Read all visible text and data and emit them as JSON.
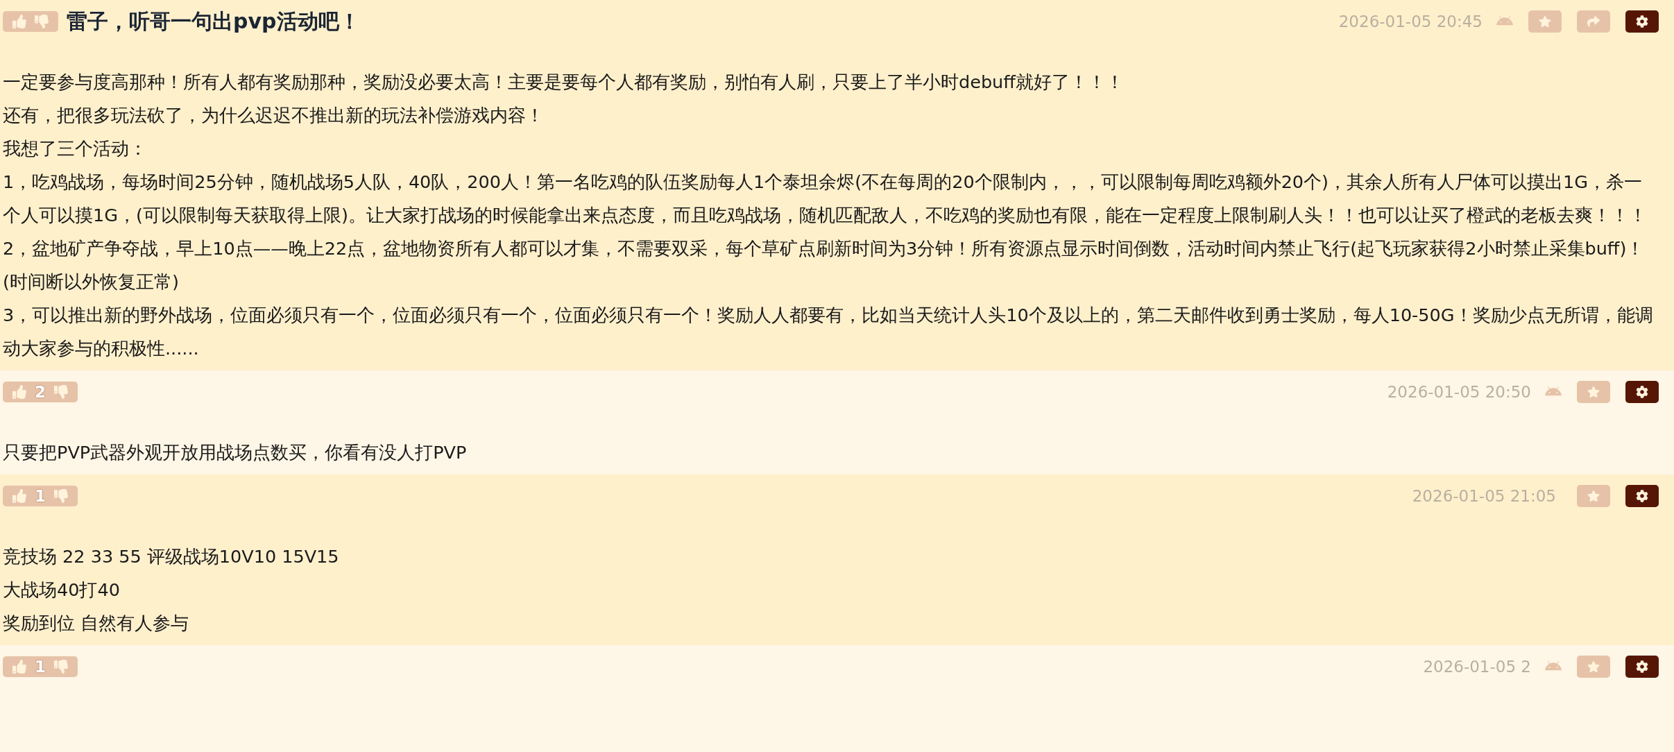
{
  "posts": [
    {
      "title": "雷子，听哥一句出pvp活动吧！",
      "time": "2026-01-05 20:45",
      "android_icon": true,
      "share": true,
      "paragraphs": [
        "一定要参与度高那种！所有人都有奖励那种，奖励没必要太高！主要是要每个人都有奖励，别怕有人刷，只要上了半小时debuff就好了！！！",
        "还有，把很多玩法砍了，为什么迟迟不推出新的玩法补偿游戏内容！",
        "我想了三个活动：",
        "1，吃鸡战场，每场时间25分钟，随机战场5人队，40队，200人！第一名吃鸡的队伍奖励每人1个泰坦余烬(不在每周的20个限制内，，，可以限制每周吃鸡额外20个)，其余人所有人尸体可以摸出1G，杀一个人可以摸1G，(可以限制每天获取得上限)。让大家打战场的时候能拿出来点态度，而且吃鸡战场，随机匹配敌人，不吃鸡的奖励也有限，能在一定程度上限制刷人头！！也可以让买了橙武的老板去爽！！！",
        "2，盆地矿产争夺战，早上10点——晚上22点，盆地物资所有人都可以才集，不需要双采，每个草矿点刷新时间为3分钟！所有资源点显示时间倒数，活动时间内禁止飞行(起飞玩家获得2小时禁止采集buff)！(时间断以外恢复正常)",
        "3，可以推出新的野外战场，位面必须只有一个，位面必须只有一个，位面必须只有一个！奖励人人都要有，比如当天统计人头10个及以上的，第二天邮件收到勇士奖励，每人10-50G！奖励少点无所谓，能调动大家参与的积极性......"
      ]
    },
    {
      "votes": "2",
      "time": "2026-01-05 20:50",
      "android_icon": true,
      "share": false,
      "paragraphs": [
        "只要把PVP武器外观开放用战场点数买，你看有没人打PVP"
      ]
    },
    {
      "votes": "1",
      "time": "2026-01-05 21:05",
      "android_icon": false,
      "share": false,
      "paragraphs": [
        "竞技场 22 33 55 评级战场10V10 15V15",
        "大战场40打40",
        "奖励到位 自然有人参与"
      ]
    },
    {
      "votes": "1",
      "time": "2026-01-05 2",
      "android_icon": true,
      "share": false
    }
  ]
}
